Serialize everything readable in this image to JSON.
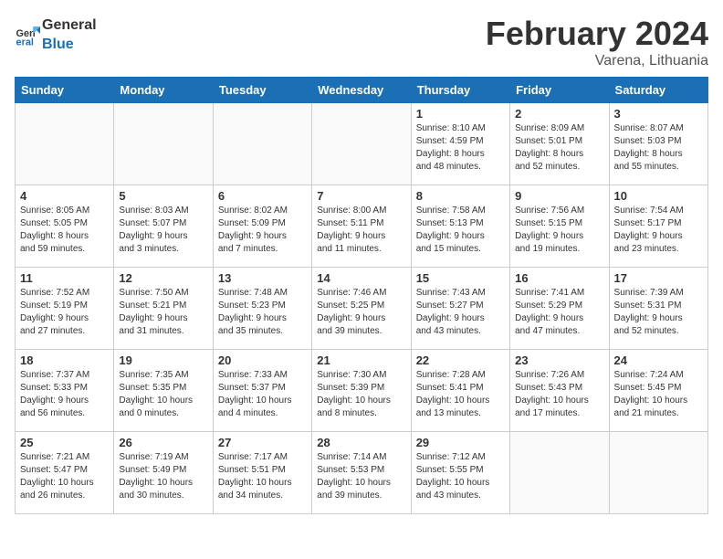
{
  "header": {
    "logo_general": "General",
    "logo_blue": "Blue",
    "month_title": "February 2024",
    "location": "Varena, Lithuania"
  },
  "weekdays": [
    "Sunday",
    "Monday",
    "Tuesday",
    "Wednesday",
    "Thursday",
    "Friday",
    "Saturday"
  ],
  "weeks": [
    [
      {
        "day": "",
        "info": ""
      },
      {
        "day": "",
        "info": ""
      },
      {
        "day": "",
        "info": ""
      },
      {
        "day": "",
        "info": ""
      },
      {
        "day": "1",
        "info": "Sunrise: 8:10 AM\nSunset: 4:59 PM\nDaylight: 8 hours\nand 48 minutes."
      },
      {
        "day": "2",
        "info": "Sunrise: 8:09 AM\nSunset: 5:01 PM\nDaylight: 8 hours\nand 52 minutes."
      },
      {
        "day": "3",
        "info": "Sunrise: 8:07 AM\nSunset: 5:03 PM\nDaylight: 8 hours\nand 55 minutes."
      }
    ],
    [
      {
        "day": "4",
        "info": "Sunrise: 8:05 AM\nSunset: 5:05 PM\nDaylight: 8 hours\nand 59 minutes."
      },
      {
        "day": "5",
        "info": "Sunrise: 8:03 AM\nSunset: 5:07 PM\nDaylight: 9 hours\nand 3 minutes."
      },
      {
        "day": "6",
        "info": "Sunrise: 8:02 AM\nSunset: 5:09 PM\nDaylight: 9 hours\nand 7 minutes."
      },
      {
        "day": "7",
        "info": "Sunrise: 8:00 AM\nSunset: 5:11 PM\nDaylight: 9 hours\nand 11 minutes."
      },
      {
        "day": "8",
        "info": "Sunrise: 7:58 AM\nSunset: 5:13 PM\nDaylight: 9 hours\nand 15 minutes."
      },
      {
        "day": "9",
        "info": "Sunrise: 7:56 AM\nSunset: 5:15 PM\nDaylight: 9 hours\nand 19 minutes."
      },
      {
        "day": "10",
        "info": "Sunrise: 7:54 AM\nSunset: 5:17 PM\nDaylight: 9 hours\nand 23 minutes."
      }
    ],
    [
      {
        "day": "11",
        "info": "Sunrise: 7:52 AM\nSunset: 5:19 PM\nDaylight: 9 hours\nand 27 minutes."
      },
      {
        "day": "12",
        "info": "Sunrise: 7:50 AM\nSunset: 5:21 PM\nDaylight: 9 hours\nand 31 minutes."
      },
      {
        "day": "13",
        "info": "Sunrise: 7:48 AM\nSunset: 5:23 PM\nDaylight: 9 hours\nand 35 minutes."
      },
      {
        "day": "14",
        "info": "Sunrise: 7:46 AM\nSunset: 5:25 PM\nDaylight: 9 hours\nand 39 minutes."
      },
      {
        "day": "15",
        "info": "Sunrise: 7:43 AM\nSunset: 5:27 PM\nDaylight: 9 hours\nand 43 minutes."
      },
      {
        "day": "16",
        "info": "Sunrise: 7:41 AM\nSunset: 5:29 PM\nDaylight: 9 hours\nand 47 minutes."
      },
      {
        "day": "17",
        "info": "Sunrise: 7:39 AM\nSunset: 5:31 PM\nDaylight: 9 hours\nand 52 minutes."
      }
    ],
    [
      {
        "day": "18",
        "info": "Sunrise: 7:37 AM\nSunset: 5:33 PM\nDaylight: 9 hours\nand 56 minutes."
      },
      {
        "day": "19",
        "info": "Sunrise: 7:35 AM\nSunset: 5:35 PM\nDaylight: 10 hours\nand 0 minutes."
      },
      {
        "day": "20",
        "info": "Sunrise: 7:33 AM\nSunset: 5:37 PM\nDaylight: 10 hours\nand 4 minutes."
      },
      {
        "day": "21",
        "info": "Sunrise: 7:30 AM\nSunset: 5:39 PM\nDaylight: 10 hours\nand 8 minutes."
      },
      {
        "day": "22",
        "info": "Sunrise: 7:28 AM\nSunset: 5:41 PM\nDaylight: 10 hours\nand 13 minutes."
      },
      {
        "day": "23",
        "info": "Sunrise: 7:26 AM\nSunset: 5:43 PM\nDaylight: 10 hours\nand 17 minutes."
      },
      {
        "day": "24",
        "info": "Sunrise: 7:24 AM\nSunset: 5:45 PM\nDaylight: 10 hours\nand 21 minutes."
      }
    ],
    [
      {
        "day": "25",
        "info": "Sunrise: 7:21 AM\nSunset: 5:47 PM\nDaylight: 10 hours\nand 26 minutes."
      },
      {
        "day": "26",
        "info": "Sunrise: 7:19 AM\nSunset: 5:49 PM\nDaylight: 10 hours\nand 30 minutes."
      },
      {
        "day": "27",
        "info": "Sunrise: 7:17 AM\nSunset: 5:51 PM\nDaylight: 10 hours\nand 34 minutes."
      },
      {
        "day": "28",
        "info": "Sunrise: 7:14 AM\nSunset: 5:53 PM\nDaylight: 10 hours\nand 39 minutes."
      },
      {
        "day": "29",
        "info": "Sunrise: 7:12 AM\nSunset: 5:55 PM\nDaylight: 10 hours\nand 43 minutes."
      },
      {
        "day": "",
        "info": ""
      },
      {
        "day": "",
        "info": ""
      }
    ]
  ]
}
